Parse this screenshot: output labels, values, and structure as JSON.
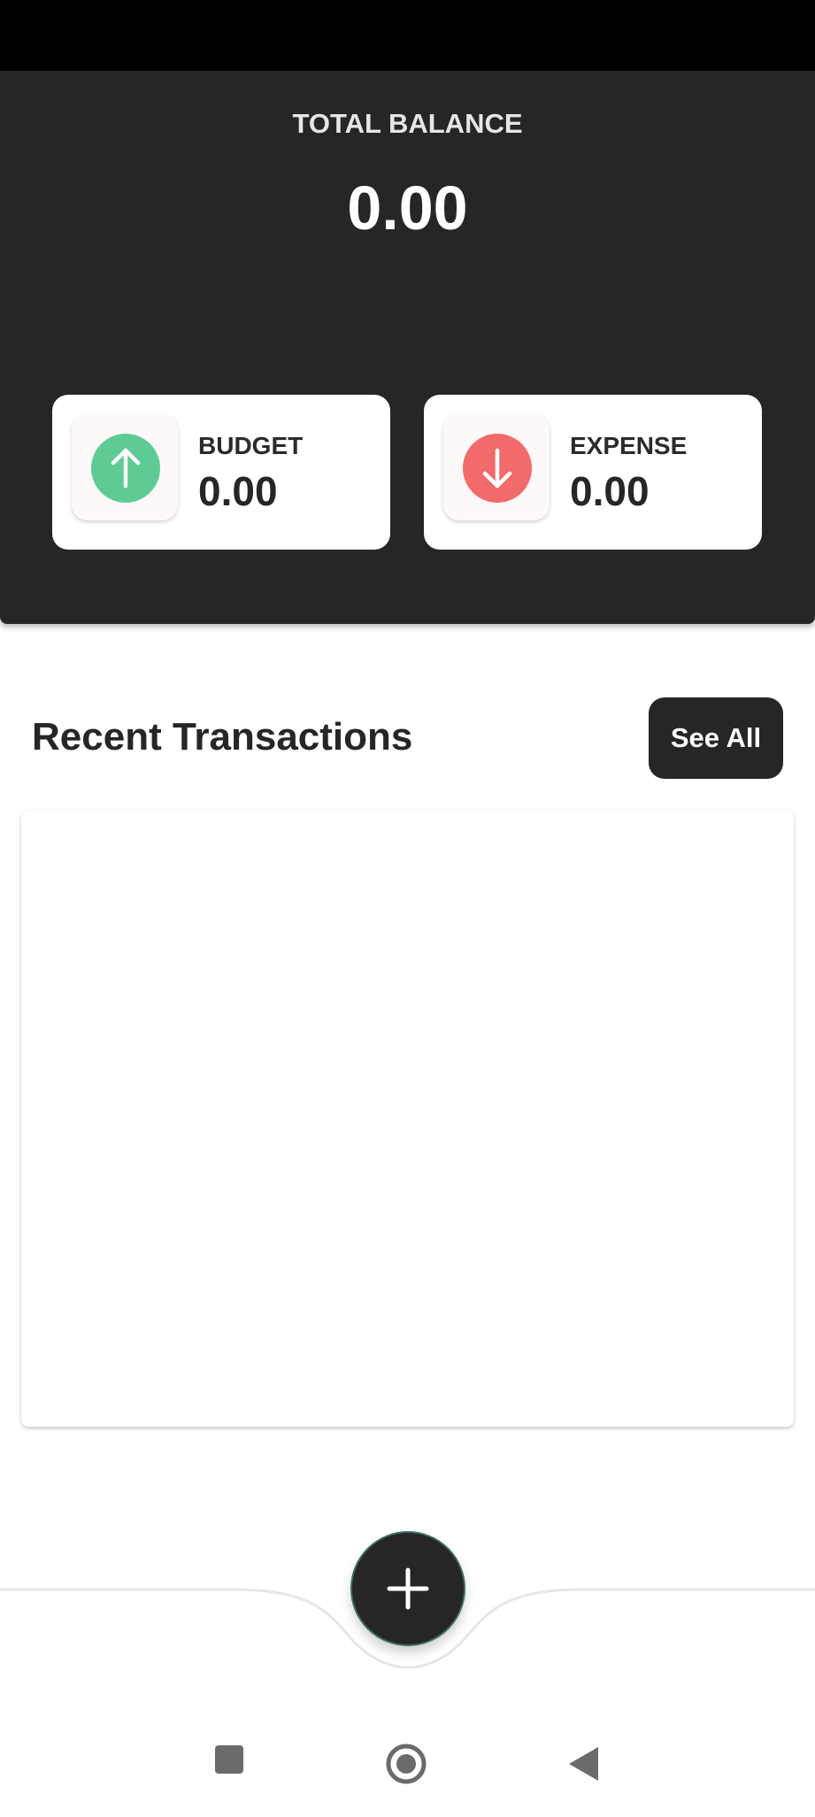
{
  "balance": {
    "label": "TOTAL BALANCE",
    "value": "0.00"
  },
  "budget": {
    "label": "BUDGET",
    "value": "0.00",
    "icon": "arrow-up-icon",
    "color": "#5ecb96"
  },
  "expense": {
    "label": "EXPENSE",
    "value": "0.00",
    "icon": "arrow-down-icon",
    "color": "#f26a6a"
  },
  "recent": {
    "title": "Recent Transactions",
    "see_all_label": "See All"
  },
  "fab": {
    "icon": "plus-icon"
  },
  "nav": {
    "recents_icon": "square-icon",
    "home_icon": "circle-icon",
    "back_icon": "triangle-back-icon"
  },
  "colors": {
    "primary_dark": "#262626",
    "status_bar": "#000000",
    "background": "#ffffff"
  }
}
